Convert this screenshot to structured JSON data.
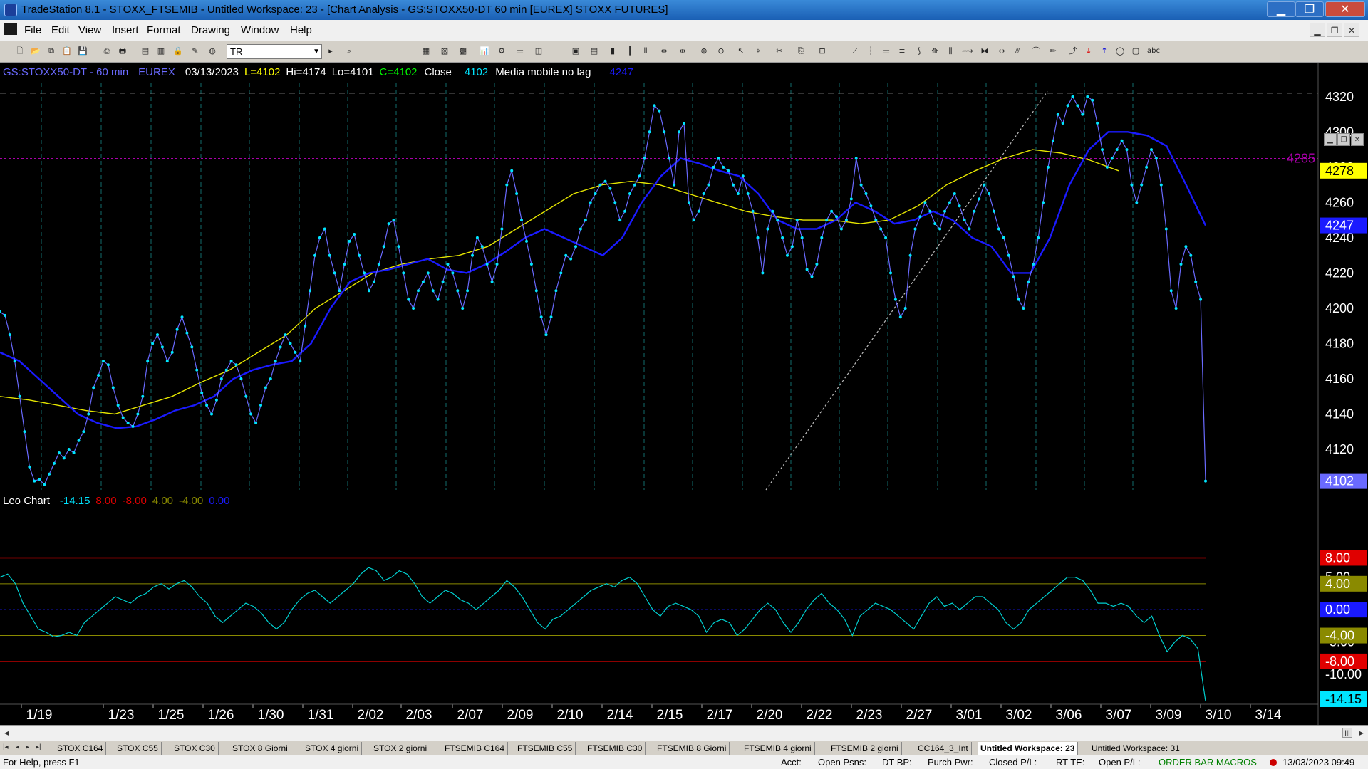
{
  "window": {
    "title": "TradeStation 8.1 - STOXX_FTSEMIB - Untitled Workspace:  23 - [Chart Analysis - GS:STOXX50-DT  60 min  [EUREX] STOXX FUTURES]"
  },
  "menu": [
    "File",
    "Edit",
    "View",
    "Insert",
    "Format",
    "Drawing",
    "Window",
    "Help"
  ],
  "toolbar": {
    "symbol_value": "TR"
  },
  "header": {
    "symbol": "GS:STOXX50-DT - 60 min",
    "exchange": "EUREX",
    "date": "03/13/2023",
    "last": "L=4102",
    "high": "Hi=4174",
    "low": "Lo=4101",
    "close": "C=4102",
    "close_word": "Close",
    "close_value": "4102",
    "indicator": "Media mobile no lag",
    "indicator_value": "4247"
  },
  "subheader": {
    "name": "Leo Chart",
    "v1": "-14.15",
    "v2": "8.00",
    "v3": "-8.00",
    "v4": "4.00",
    "v5": "-4.00",
    "v6": "0.00"
  },
  "colors": {
    "price": "#6a6aff",
    "dots": "#00e5ff",
    "ma_blue": "#1a1aff",
    "ma_yellow": "#e6e600",
    "osc": "#00d0d0",
    "red": "#e00000",
    "olive": "#8a8a00",
    "purple": "#aa00aa"
  },
  "chart_data": [
    {
      "type": "line",
      "name": "price",
      "ylim": [
        4097,
        4328
      ],
      "price_ticks": [
        "4320",
        "4300",
        "4280",
        "4260",
        "4240",
        "4220",
        "4200",
        "4180",
        "4160",
        "4140",
        "4120"
      ],
      "markers": [
        {
          "label": "4285",
          "value": 4285,
          "color": "#aa00aa"
        },
        {
          "label": "4278",
          "value": 4278,
          "color": "#ffff00"
        },
        {
          "label": "4247",
          "value": 4247,
          "color": "#1a1aff"
        },
        {
          "label": "4102",
          "value": 4102,
          "color": "#6a6aff"
        }
      ],
      "series": [
        {
          "values": [
            4198,
            4196,
            4185,
            4170,
            4150,
            4130,
            4110,
            4102,
            4103,
            4100,
            4106,
            4112,
            4118,
            4115,
            4120,
            4118,
            4125,
            4130,
            4140,
            4155,
            4162,
            4170,
            4168,
            4155,
            4145,
            4138,
            4135,
            4133,
            4140,
            4150,
            4170,
            4180,
            4185,
            4178,
            4170,
            4175,
            4188,
            4195,
            4186,
            4178,
            4165,
            4152,
            4145,
            4140,
            4148,
            4160,
            4165,
            4170,
            4168,
            4160,
            4150,
            4140,
            4135,
            4145,
            4155,
            4160,
            4170,
            4178,
            4185,
            4180,
            4175,
            4170,
            4190,
            4210,
            4230,
            4240,
            4245,
            4230,
            4220,
            4210,
            4225,
            4238,
            4242,
            4230,
            4220,
            4210,
            4215,
            4225,
            4235,
            4248,
            4250,
            4235,
            4220,
            4205,
            4200,
            4210,
            4215,
            4220,
            4210,
            4205,
            4215,
            4225,
            4220,
            4210,
            4200,
            4210,
            4230,
            4240,
            4235,
            4225,
            4215,
            4225,
            4245,
            4270,
            4278,
            4265,
            4250,
            4238,
            4225,
            4210,
            4195,
            4185,
            4195,
            4210,
            4220,
            4230,
            4228,
            4235,
            4245,
            4250,
            4260,
            4265,
            4270,
            4272,
            4268,
            4260,
            4250,
            4255,
            4265,
            4270,
            4275,
            4285,
            4300,
            4315,
            4312,
            4300,
            4285,
            4270,
            4300,
            4305,
            4260,
            4250,
            4255,
            4265,
            4270,
            4280,
            4285,
            4280,
            4278,
            4270,
            4265,
            4275,
            4265,
            4255,
            4240,
            4220,
            4245,
            4255,
            4250,
            4240,
            4230,
            4235,
            4250,
            4240,
            4222,
            4218,
            4225,
            4240,
            4250,
            4255,
            4252,
            4245,
            4250,
            4262,
            4285,
            4270,
            4265,
            4258,
            4250,
            4245,
            4240,
            4220,
            4205,
            4195,
            4200,
            4230,
            4245,
            4252,
            4260,
            4255,
            4248,
            4245,
            4255,
            4260,
            4265,
            4258,
            4250,
            4245,
            4255,
            4262,
            4270,
            4265,
            4255,
            4245,
            4240,
            4230,
            4218,
            4205,
            4200,
            4215,
            4225,
            4240,
            4260,
            4280,
            4295,
            4310,
            4305,
            4315,
            4320,
            4315,
            4310,
            4320,
            4318,
            4305,
            4290,
            4280,
            4285,
            4290,
            4295,
            4290,
            4270,
            4260,
            4270,
            4280,
            4290,
            4285,
            4270,
            4245,
            4210,
            4200,
            4225,
            4235,
            4230,
            4215,
            4205,
            4102
          ]
        },
        {
          "values": [
            4175,
            4170,
            4160,
            4150,
            4140,
            4135,
            4132,
            4133,
            4137,
            4142,
            4145,
            4150,
            4160,
            4165,
            4168,
            4170,
            4180,
            4200,
            4215,
            4220,
            4222,
            4225,
            4228,
            4222,
            4220,
            4225,
            4232,
            4240,
            4245,
            4240,
            4235,
            4230,
            4240,
            4260,
            4275,
            4285,
            4282,
            4278,
            4275,
            4265,
            4250,
            4245,
            4245,
            4250,
            4260,
            4255,
            4248,
            4250,
            4255,
            4250,
            4240,
            4235,
            4220,
            4220,
            4240,
            4270,
            4290,
            4300,
            4300,
            4298,
            4292,
            4270,
            4247
          ]
        },
        {
          "values": [
            4150,
            4148,
            4145,
            4142,
            4140,
            4145,
            4150,
            4158,
            4165,
            4175,
            4185,
            4200,
            4210,
            4220,
            4225,
            4228,
            4230,
            4235,
            4245,
            4255,
            4265,
            4270,
            4272,
            4270,
            4265,
            4260,
            4255,
            4252,
            4250,
            4250,
            4248,
            4250,
            4258,
            4270,
            4278,
            4285,
            4290,
            4288,
            4284,
            4278
          ]
        }
      ]
    },
    {
      "type": "line",
      "name": "oscillator",
      "ylim": [
        -14.5,
        7.5
      ],
      "osc_ticks": [
        "5.00",
        "-5.00",
        "-10.00"
      ],
      "levels": [
        {
          "label": "8.00",
          "value": 8,
          "color": "#e00000"
        },
        {
          "label": "4.00",
          "value": 4,
          "color": "#8a8a00"
        },
        {
          "label": "0.00",
          "value": 0,
          "color": "#1a1aff"
        },
        {
          "label": "-4.00",
          "value": -4,
          "color": "#8a8a00"
        },
        {
          "label": "-8.00",
          "value": -8,
          "color": "#e00000"
        },
        {
          "label": "-14.15",
          "value": -14.15,
          "color": "#00e5ff"
        }
      ],
      "series": [
        {
          "values": [
            5,
            5.5,
            4,
            1,
            -1,
            -3,
            -3.5,
            -4.2,
            -4,
            -3.5,
            -4,
            -2,
            -1,
            0,
            1,
            2,
            1.5,
            1,
            2,
            2.5,
            3.5,
            4,
            3.2,
            4,
            4.5,
            3.5,
            2,
            1,
            -1,
            -2,
            -1,
            0,
            1,
            0.5,
            -0.5,
            -2,
            -3,
            -2,
            0,
            1.5,
            2.5,
            3,
            2,
            1,
            2,
            3,
            4,
            5.5,
            6.5,
            6,
            4.5,
            5,
            6,
            5.5,
            4,
            2,
            1,
            2,
            3,
            2.5,
            1.5,
            1,
            0,
            1,
            2,
            3,
            4.5,
            3.5,
            2,
            0,
            -2,
            -3,
            -1.5,
            -1,
            0,
            1,
            2,
            3,
            3.5,
            4,
            3.5,
            4.5,
            5,
            4,
            2,
            0,
            -1,
            0.5,
            1,
            0.5,
            0,
            -1,
            -3.5,
            -2,
            -1.5,
            -2,
            -4,
            -3,
            -1.5,
            0,
            1,
            0,
            -2,
            -3.5,
            -2,
            0,
            1.5,
            2.5,
            1,
            0,
            -1.5,
            -4,
            -1,
            0,
            1,
            0.5,
            0,
            -1,
            -2,
            -3,
            -1,
            1,
            2,
            0.5,
            1,
            0,
            1,
            2,
            2,
            1,
            0,
            -2,
            -3,
            -2,
            0,
            1,
            2,
            3,
            4,
            5,
            5,
            4.5,
            3,
            1,
            1,
            0.5,
            1,
            0.5,
            -1,
            -2,
            -1,
            -4,
            -6.5,
            -5,
            -4,
            -4.5,
            -6,
            -14.15
          ]
        }
      ]
    }
  ],
  "xaxis": {
    "labels": [
      "1/19",
      "1/23",
      "1/25",
      "1/26",
      "1/30",
      "1/31",
      "2/02",
      "2/03",
      "2/07",
      "2/09",
      "2/10",
      "2/14",
      "2/15",
      "2/17",
      "2/20",
      "2/22",
      "2/23",
      "2/27",
      "3/01",
      "3/02",
      "3/06",
      "3/07",
      "3/09",
      "3/10",
      "3/14"
    ]
  },
  "tabs": [
    "STOX C164",
    "STOX C55",
    "STOX  C30",
    "STOX  8 Giorni",
    "STOX 4 giorni",
    "STOX  2 giorni",
    "FTSEMIB C164",
    "FTSEMIB C55",
    "FTSEMIB C30",
    "FTSEMIB  8 Giorni",
    "FTSEMIB  4 giorni",
    "FTSEMIB  2 giorni",
    "CC164_3_Int",
    "Untitled Workspace:  23",
    "Untitled Workspace:  31"
  ],
  "status": {
    "help": "For Help, press F1",
    "acct": "Acct:",
    "open_psns": "Open Psns:",
    "dt_bp": "DT BP:",
    "purch_pwr": "Purch Pwr:",
    "closed_pl": "Closed P/L:",
    "rt_te": "RT TE:",
    "open_pl": "Open P/L:",
    "macros": "ORDER BAR  MACROS",
    "datetime": "13/03/2023 09:49"
  }
}
